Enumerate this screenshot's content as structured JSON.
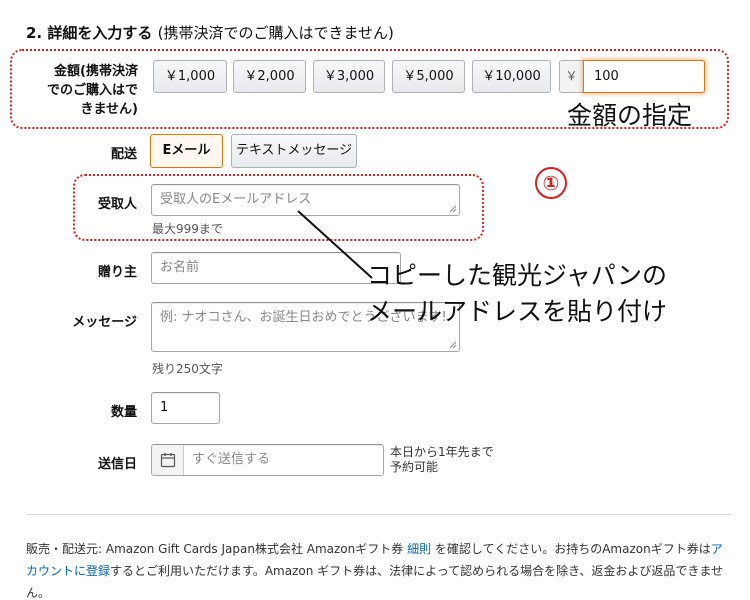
{
  "section": {
    "title": "2. 詳細を入力する",
    "subtitle": "(携帯決済でのご購入はできません)"
  },
  "amount": {
    "label_line1": "金額(携帯決済",
    "label_line2": "でのご購入はで",
    "label_line3": "きません)",
    "presets": [
      "￥1,000",
      "￥2,000",
      "￥3,000",
      "￥5,000",
      "￥10,000"
    ],
    "currency_prefix": "￥",
    "custom_value": "100"
  },
  "delivery": {
    "label": "配送",
    "email_option": "Eメール",
    "text_option": "テキストメッセージ"
  },
  "recipient": {
    "label": "受取人",
    "placeholder": "受取人のEメールアドレス",
    "hint": "最大999まで"
  },
  "sender": {
    "label": "贈り主",
    "placeholder": "お名前"
  },
  "message": {
    "label": "メッセージ",
    "placeholder": "例: ナオコさん、お誕生日おめでとうございます!",
    "hint": "残り250文字"
  },
  "quantity": {
    "label": "数量",
    "value": "1"
  },
  "send_date": {
    "label": "送信日",
    "placeholder": "すぐ送信する",
    "note_line1": "本日から1年先まで",
    "note_line2": "予約可能"
  },
  "annotations": {
    "amount_note": "金額の指定",
    "step_marker": "①",
    "paste_line1": "コピーした観光ジャパンの",
    "paste_line2": "メールアドレスを貼り付け",
    "annotation_color": "#e31b1b"
  },
  "footer": {
    "part1": "販売・配送元: Amazon Gift Cards Japan株式会社 Amazonギフト券 ",
    "link_details": "細則",
    "part2": " を確認してください。お持ちのAmazonギフト券は",
    "link_account": "アカウントに登録",
    "part3": "するとご利用いただけます。Amazon ギフト券は、法律によって認められる場合を除き、返金および返品できません。"
  },
  "icons": {
    "calendar": "calendar-icon",
    "resize": "resize-grip-icon"
  },
  "colors": {
    "accent_orange": "#e77600",
    "link_blue": "#0066c0",
    "annotation_red": "#e31b1b"
  }
}
